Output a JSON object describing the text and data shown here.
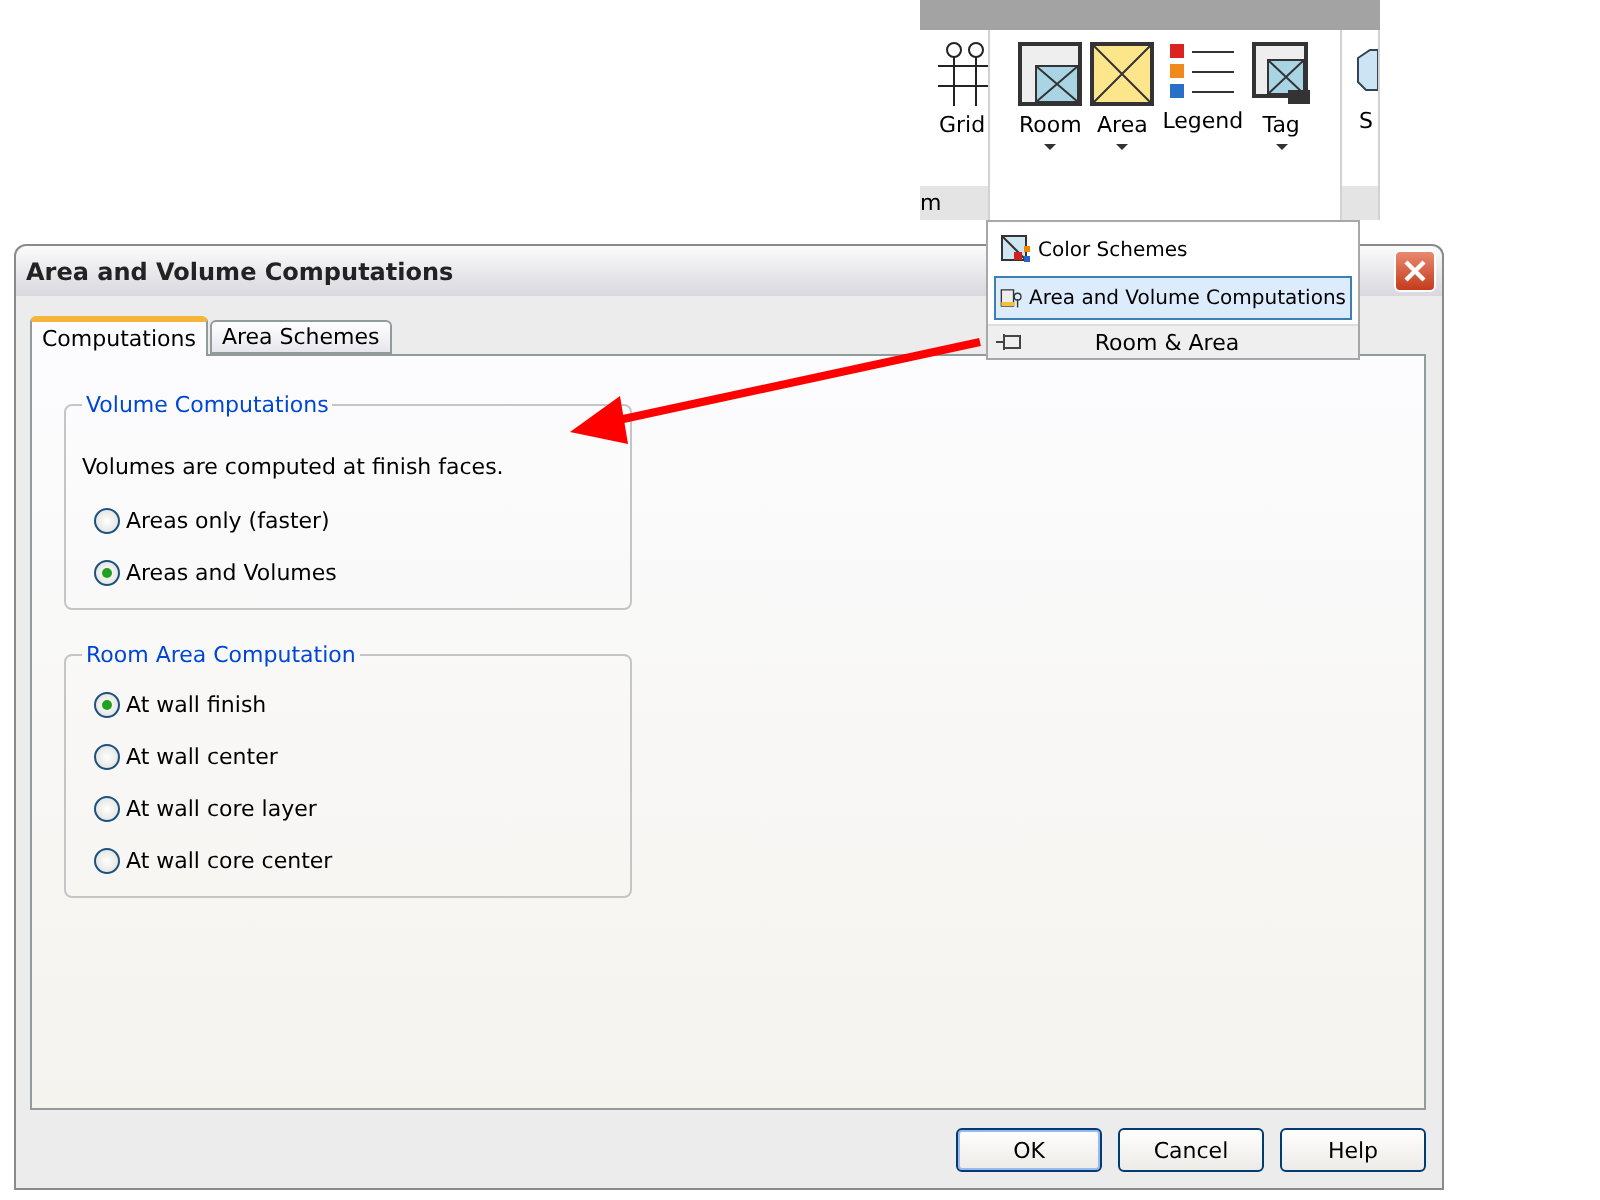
{
  "ribbon": {
    "panel_label": "m",
    "tools": [
      {
        "label": "Grid",
        "kind": "grid",
        "dropdown": false
      },
      {
        "label": "Room",
        "kind": "room",
        "dropdown": true
      },
      {
        "label": "Area",
        "kind": "area",
        "dropdown": true
      },
      {
        "label": "Legend",
        "kind": "legend",
        "dropdown": false
      },
      {
        "label": "Tag",
        "kind": "tag",
        "dropdown": true
      },
      {
        "label": "S",
        "kind": "partial",
        "dropdown": false
      }
    ]
  },
  "menu": {
    "items": [
      {
        "label": "Color Schemes",
        "kind": "schemes",
        "selected": false
      },
      {
        "label": "Area and Volume Computations",
        "kind": "computations",
        "selected": true
      }
    ],
    "footer": "Room & Area"
  },
  "dialog": {
    "title": "Area and Volume Computations",
    "tabs": [
      {
        "label": "Computations",
        "selected": true
      },
      {
        "label": "Area Schemes",
        "selected": false
      }
    ],
    "groups": [
      {
        "title": "Volume Computations",
        "note": "Volumes are computed at finish faces.",
        "options": [
          {
            "label": "Areas only (faster)",
            "selected": false
          },
          {
            "label": "Areas and Volumes",
            "selected": true
          }
        ]
      },
      {
        "title": "Room Area Computation",
        "options": [
          {
            "label": "At wall finish",
            "selected": true
          },
          {
            "label": "At wall center",
            "selected": false
          },
          {
            "label": "At wall core layer",
            "selected": false
          },
          {
            "label": "At wall core center",
            "selected": false
          }
        ]
      }
    ],
    "buttons": [
      "OK",
      "Cancel",
      "Help"
    ]
  }
}
